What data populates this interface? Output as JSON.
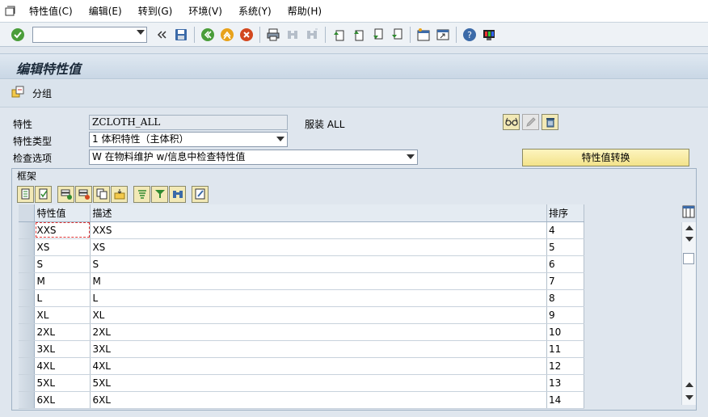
{
  "menubar": {
    "items": [
      {
        "label": "特性值(C)"
      },
      {
        "label": "编辑(E)"
      },
      {
        "label": "转到(G)"
      },
      {
        "label": "环境(V)"
      },
      {
        "label": "系统(Y)"
      },
      {
        "label": "帮助(H)"
      }
    ]
  },
  "toolbar": {
    "command_value": "",
    "icons": [
      "enter-check-icon",
      "double-left-icon",
      "save-icon",
      "back-icon",
      "exit-icon",
      "cancel-icon",
      "print-icon",
      "find-icon",
      "find-next-icon",
      "first-page-icon",
      "prev-page-icon",
      "next-page-icon",
      "last-page-icon",
      "new-session-icon",
      "shortcut-icon",
      "help-icon",
      "customize-layout-icon"
    ]
  },
  "title": "编辑特性值",
  "appbar": {
    "group_label": "分组"
  },
  "form": {
    "characteristic_label": "特性",
    "characteristic_value": "ZCLOTH_ALL",
    "characteristic_desc": "服装 ALL",
    "type_label": "特性类型",
    "type_value": "1 体积特性（主体积）",
    "check_label": "检查选项",
    "check_value": "W 在物料维护 w/信息中检查特性值",
    "convert_button": "特性值转换"
  },
  "frame": {
    "title": "框架",
    "table": {
      "headers": [
        "特性值",
        "描述",
        "排序"
      ],
      "rows": [
        [
          "XXS",
          "XXS",
          "4"
        ],
        [
          "XS",
          "XS",
          "5"
        ],
        [
          "S",
          "S",
          "6"
        ],
        [
          "M",
          "M",
          "7"
        ],
        [
          "L",
          "L",
          "8"
        ],
        [
          "XL",
          "XL",
          "9"
        ],
        [
          "2XL",
          "2XL",
          "10"
        ],
        [
          "3XL",
          "3XL",
          "11"
        ],
        [
          "4XL",
          "4XL",
          "12"
        ],
        [
          "5XL",
          "5XL",
          "13"
        ],
        [
          "6XL",
          "6XL",
          "14"
        ]
      ]
    }
  },
  "colors": {
    "accent_yellow": "#f3e38a",
    "background": "#dfe6ee",
    "title_bar": "#c9d7e5"
  }
}
